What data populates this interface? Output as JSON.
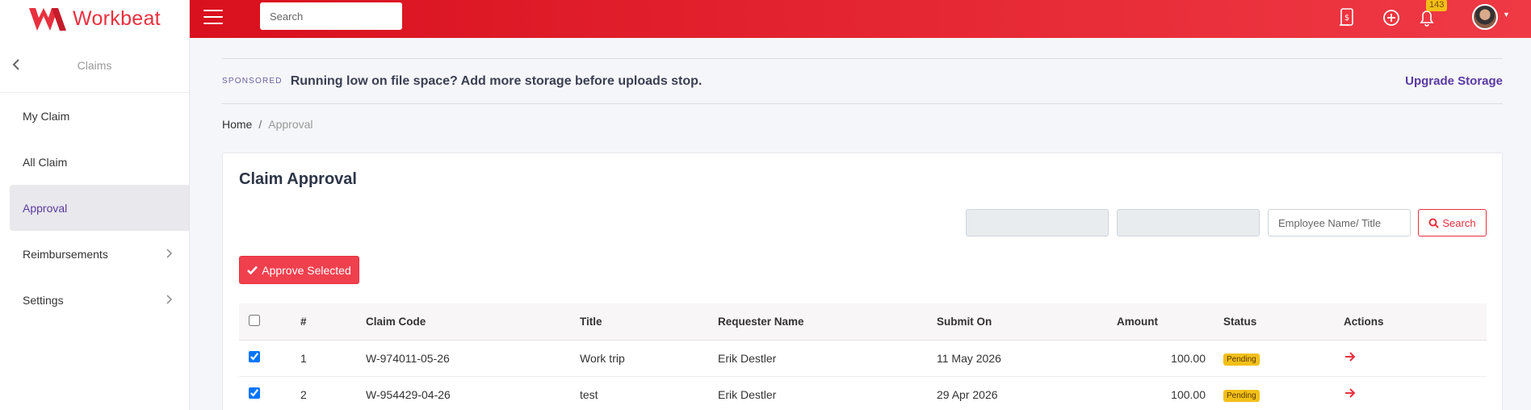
{
  "brand": {
    "name": "Workbeat",
    "accent": "#e8303e"
  },
  "topbar": {
    "search_placeholder": "Search",
    "notification_count": "143",
    "icons": [
      "scroll-dollar-icon",
      "plus-circle-icon",
      "bell-icon"
    ]
  },
  "sidebar": {
    "back_title": "Claims",
    "items": [
      {
        "label": "My Claim",
        "active": false,
        "has_children": false
      },
      {
        "label": "All Claim",
        "active": false,
        "has_children": false
      },
      {
        "label": "Approval",
        "active": true,
        "has_children": false
      },
      {
        "label": "Reimbursements",
        "active": false,
        "has_children": true
      },
      {
        "label": "Settings",
        "active": false,
        "has_children": true
      }
    ]
  },
  "sponsored": {
    "tag": "SPONSORED",
    "message": "Running low on file space? Add more storage before uploads stop.",
    "link": "Upgrade Storage"
  },
  "breadcrumb": {
    "home": "Home",
    "sep": "/",
    "current": "Approval"
  },
  "card": {
    "title": "Claim Approval",
    "filter_placeholder": "Employee Name/ Title",
    "search_label": "Search",
    "approve_label": "Approve Selected"
  },
  "table": {
    "headers": [
      "#",
      "Claim Code",
      "Title",
      "Requester Name",
      "Submit On",
      "Amount",
      "Status",
      "Actions"
    ],
    "rows": [
      {
        "no": "1",
        "code": "W-974011-05-26",
        "title": "Work trip",
        "requester": "Erik Destler",
        "submitted": "11 May 2026",
        "amount": "100.00",
        "status": "Pending",
        "checked": true
      },
      {
        "no": "2",
        "code": "W-954429-04-26",
        "title": "test",
        "requester": "Erik Destler",
        "submitted": "29 Apr 2026",
        "amount": "100.00",
        "status": "Pending",
        "checked": true
      }
    ]
  }
}
